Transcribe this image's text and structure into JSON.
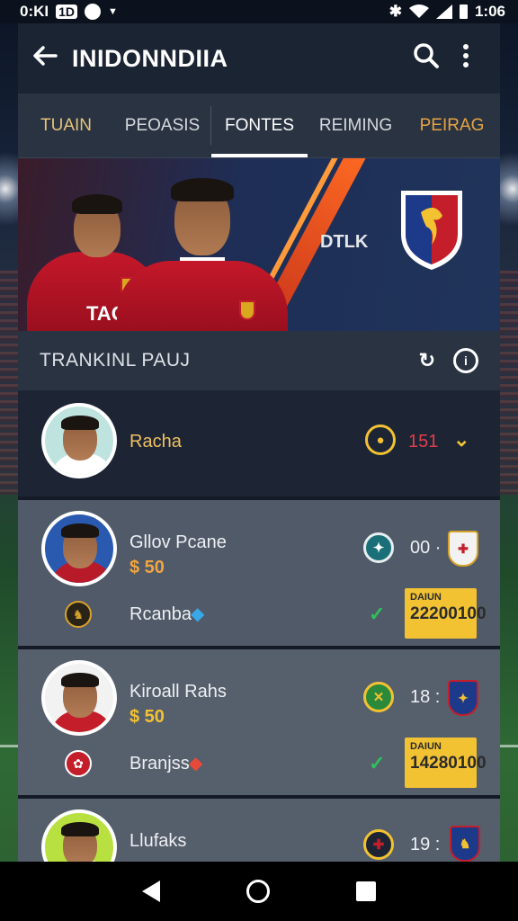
{
  "status_bar": {
    "left_text": "0:KI",
    "left_badge": "1D",
    "time": "1:06"
  },
  "header": {
    "title": "INIDONNDIIA"
  },
  "tabs": [
    {
      "label": "TUAIN"
    },
    {
      "label": "PEOASIS"
    },
    {
      "label": "FONTES"
    },
    {
      "label": "REIMING"
    },
    {
      "label": "PEIRAG"
    }
  ],
  "banner": {
    "shirt_text": "TAG",
    "center_text": "DTLK"
  },
  "section": {
    "title": "TRANKINL PAUJ"
  },
  "players": [
    {
      "name": "Racha",
      "score": "151"
    },
    {
      "name": "Gllov Pcane",
      "price": "$ 50",
      "score": "00 ·",
      "club": "Rcanba",
      "value_label": "DAIUN",
      "value": "22200100"
    },
    {
      "name": "Kiroall Rahs",
      "price": "$ 50",
      "score": "18 :",
      "club": "Branjss",
      "value_label": "DAIUN",
      "value": "14280100"
    },
    {
      "name": "Llufaks",
      "score": "19 :"
    }
  ],
  "icons": {
    "back": "arrow-left-icon",
    "search": "search-icon",
    "menu": "more-vertical-icon",
    "refresh": "refresh-icon",
    "info": "info-icon"
  },
  "colors": {
    "accent_gold": "#f2c233",
    "primary_red": "#c4182a",
    "tab_active": "#ffffff",
    "check_green": "#2fbf5c"
  }
}
